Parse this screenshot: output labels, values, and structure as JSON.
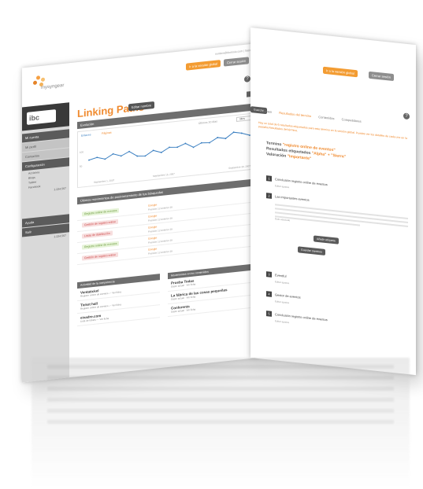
{
  "front": {
    "header": {
      "orange_button": "Ir a la versión global",
      "grey_button": "Cerrar sesión",
      "top_small_links": "nombre@dominio.com  |  Salir"
    },
    "brand": {
      "logo_text": "mysyngear"
    },
    "sidebar": {
      "logo_text": "ibc",
      "items": [
        {
          "label": "Mi cuenta",
          "style": "dark"
        },
        {
          "label": "Mi perfil",
          "style": "light"
        },
        {
          "label": "Contactos",
          "style": "light"
        },
        {
          "label": "Configuración",
          "style": "dark"
        }
      ],
      "subitems": [
        "Acciones",
        "Blogs",
        "Twitter",
        "Facebook"
      ],
      "counter": "1.234.567",
      "bottom_items": [
        "Ayuda",
        "Salir"
      ],
      "bottom_counter": "1.234.567"
    },
    "page_title": "Linking Paths",
    "title_button": "Editar nombre",
    "evolution_bar": "Evolución",
    "chart_legend": [
      "Enlaces",
      "Páginas"
    ],
    "chart_range_label": "Últimos 30 días",
    "chart_select": "Mes",
    "chart_x_labels": [
      "Septiembre 1, 2007",
      "Septiembre 15, 2007",
      "Septiembre 30, 2007"
    ],
    "chart_y_labels": [
      "100",
      "50"
    ],
    "chart_data": {
      "type": "line",
      "x": [
        "1",
        "2",
        "3",
        "4",
        "5",
        "6",
        "7",
        "8",
        "9",
        "10",
        "11",
        "12",
        "13",
        "14",
        "15",
        "16",
        "17",
        "18",
        "19",
        "20",
        "21"
      ],
      "series": [
        {
          "values": [
            50,
            55,
            48,
            60,
            52,
            62,
            47,
            45,
            58,
            50,
            62,
            60,
            68,
            55,
            65,
            63,
            75,
            70,
            85,
            80,
            72
          ]
        }
      ]
    },
    "ranking_bar": "Últimos movimientos de posicionamiento de tus búsquedas",
    "rows": [
      {
        "tag": "Registro online de eventos",
        "kind": "g",
        "value": "Google",
        "sub": "Posición 12  Anterior 29"
      },
      {
        "tag": "Gestión de registro online",
        "kind": "r",
        "value": "Google",
        "sub": "Posición 12  Anterior 29"
      },
      {
        "tag": "Listas de distribución",
        "kind": "r",
        "value": "Google",
        "sub": "Posición 12  Anterior 29"
      },
      {
        "tag": "Registro online de eventos",
        "kind": "g",
        "value": "Google",
        "sub": "Posición 12  Anterior 29"
      },
      {
        "tag": "Gestión de registro online",
        "kind": "r",
        "value": "Google",
        "sub": "Posición 12  Anterior 29"
      }
    ],
    "col_left_head": "Actividad de la competencia",
    "col_left": [
      {
        "title": "Ventatickel",
        "desc": "Registro online de eventos — Ver ficha"
      },
      {
        "title": "Ticket hall",
        "desc": "Registro online de eventos — Ver ficha"
      },
      {
        "title": "eixadre.com",
        "desc": "Lista de tickets — Ver ficha"
      }
    ],
    "col_right_head": "Movimientos en los contenidos",
    "col_right": [
      {
        "title": "Prueba Todas",
        "desc": "Gasto actual · Ver ficha"
      },
      {
        "title": "La fábrica de las cosas pequeñas",
        "desc": "Gasto actual · Ver ficha"
      },
      {
        "title": "Conferents",
        "desc": "Gasto actual · Ver ficha"
      }
    ]
  },
  "back": {
    "header": {
      "orange_button": "Ir a la versión global",
      "grey_button": "Cerrar sesión"
    },
    "top_bar": "Guardar",
    "tabs": [
      "Resumen",
      "Resultados del término",
      "Contenidos",
      "Competidores"
    ],
    "notice": "Hay un total de 6 resultados etiquetados para este término en la versión global. Puedes ver los detalles de cada uno en la pestaña Resultados del término.",
    "term_label": "Termino",
    "term_value": "\"registro online de eventos\"",
    "results_label": "Resultados etiquetados",
    "results_value": "\"Alpha\" + \"Sierra\"",
    "valuation_label": "Valoración",
    "valuation_value": "\"Importante\"",
    "sections": [
      {
        "num": "1",
        "label": "Conclusión registro online de eventos",
        "meta": "Editar ajustes"
      },
      {
        "num": "2",
        "label": "Las importantes eventos",
        "meta": "Dato asociado"
      },
      {
        "num": "3",
        "label": "Eventful",
        "meta": "Editar ajustes"
      },
      {
        "num": "4",
        "label": "Gestor de eventos",
        "meta": "Editar ajustes"
      },
      {
        "num": "5",
        "label": "Conclusión registro online de eventos",
        "meta": "Editar ajustes"
      }
    ],
    "save_button": "Añadir etiqueta",
    "filter_button": "Guardar cambios"
  }
}
